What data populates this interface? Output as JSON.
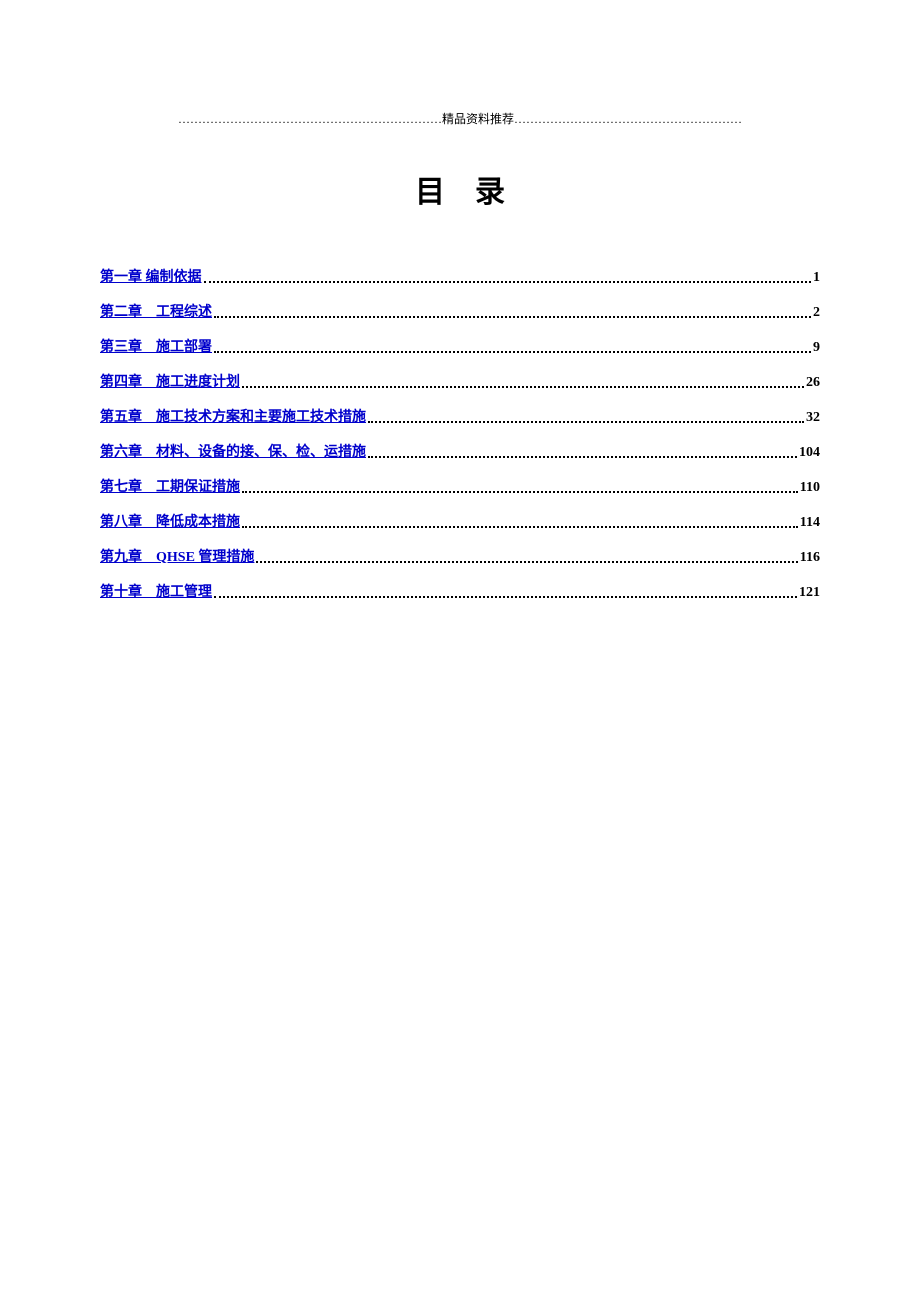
{
  "header_text": "…………………………………………………………精品资料推荐…………………………………………………",
  "title": "目录",
  "toc": [
    {
      "label": "第一章 编制依据",
      "page": "1"
    },
    {
      "label": "第二章　工程综述",
      "page": "2"
    },
    {
      "label": "第三章　施工部署",
      "page": "9"
    },
    {
      "label": "第四章　施工进度计划",
      "page": "26"
    },
    {
      "label": "第五章　施工技术方案和主要施工技术措施",
      "page": "32"
    },
    {
      "label": "第六章　材料、设备的接、保、检、运措施",
      "page": "104"
    },
    {
      "label": "第七章　工期保证措施",
      "page": "110"
    },
    {
      "label": "第八章　降低成本措施",
      "page": "114"
    },
    {
      "label": "第九章　QHSE 管理措施",
      "page": "116"
    },
    {
      "label": "第十章　施工管理",
      "page": "121"
    }
  ]
}
